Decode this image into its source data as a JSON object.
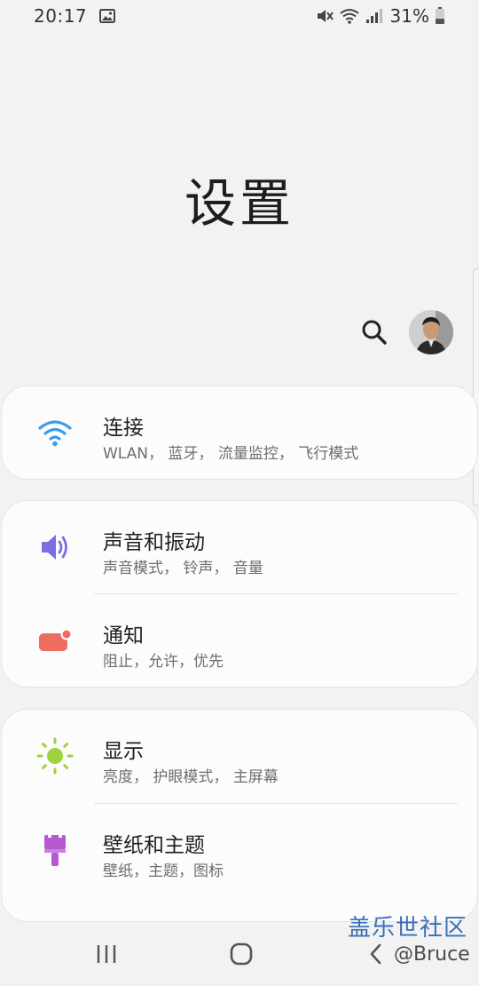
{
  "status_bar": {
    "time": "20:17",
    "battery_text": "31%"
  },
  "page": {
    "title": "设置"
  },
  "groups": [
    {
      "items": [
        {
          "title": "连接",
          "subtitle": "WLAN， 蓝牙， 流量监控， 飞行模式",
          "icon": "wifi-icon",
          "icon_color": "#3d9be9"
        }
      ]
    },
    {
      "items": [
        {
          "title": "声音和振动",
          "subtitle": "声音模式， 铃声， 音量",
          "icon": "volume-icon",
          "icon_color": "#7a6ee0"
        },
        {
          "title": "通知",
          "subtitle": "阻止，允许，优先",
          "icon": "notification-icon",
          "icon_color": "#ef6d5e"
        }
      ]
    },
    {
      "items": [
        {
          "title": "显示",
          "subtitle": "亮度， 护眼模式， 主屏幕",
          "icon": "brightness-icon",
          "icon_color": "#9ed23c"
        },
        {
          "title": "壁纸和主题",
          "subtitle": "壁纸，主题，图标",
          "icon": "paint-brush-icon",
          "icon_color": "#b55ad0"
        }
      ]
    }
  ],
  "overlay": {
    "watermark": "盖乐世社区",
    "watermark_user": "@Bruce"
  }
}
